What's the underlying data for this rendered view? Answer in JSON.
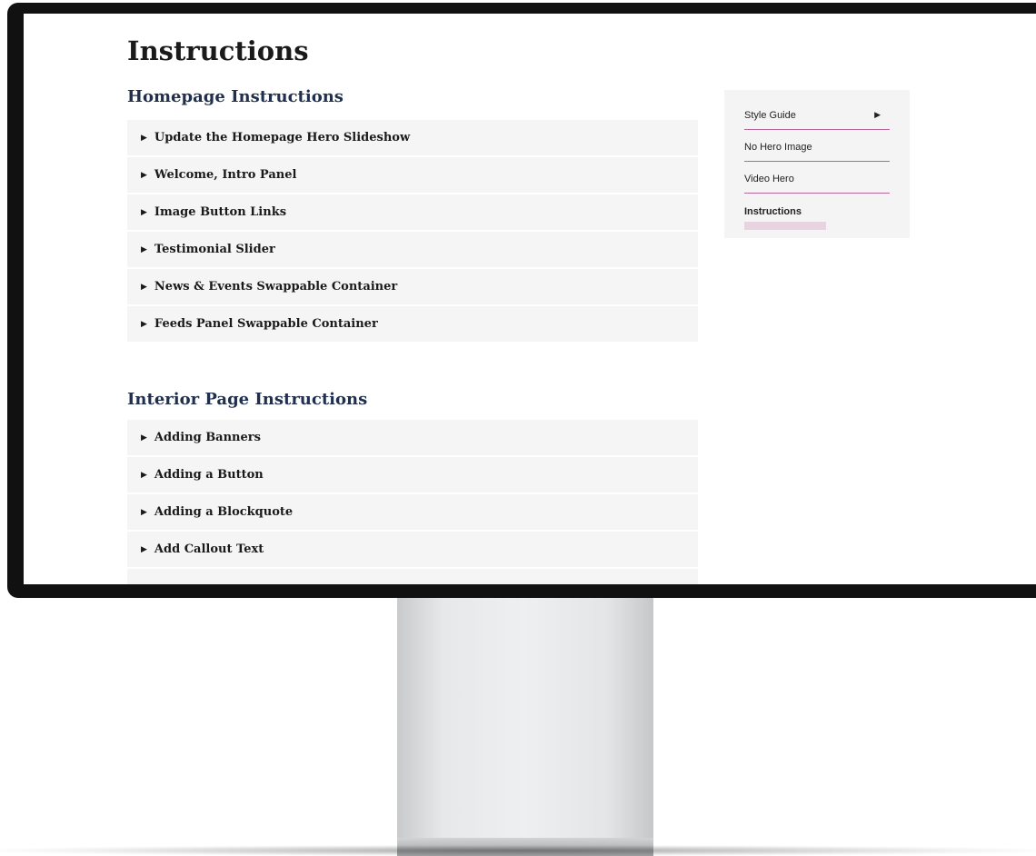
{
  "page": {
    "title": "Instructions"
  },
  "homepage": {
    "heading": "Homepage Instructions",
    "items": [
      "Update the Homepage Hero Slideshow",
      "Welcome, Intro Panel",
      "Image Button Links",
      "Testimonial Slider",
      "News & Events Swappable Container",
      "Feeds Panel Swappable Container"
    ]
  },
  "interior": {
    "heading": "Interior Page Instructions",
    "items": [
      "Adding Banners",
      "Adding a Button",
      "Adding a Blockquote",
      "Add Callout Text"
    ]
  },
  "sidebar": {
    "items": [
      {
        "label": "Style Guide",
        "has_submenu": true
      },
      {
        "label": "No Hero Image"
      },
      {
        "label": "Video Hero"
      },
      {
        "label": "Instructions",
        "active": true
      }
    ],
    "accent_color": "#b5679a"
  },
  "icons": {
    "expand": "triangle-right-icon"
  }
}
